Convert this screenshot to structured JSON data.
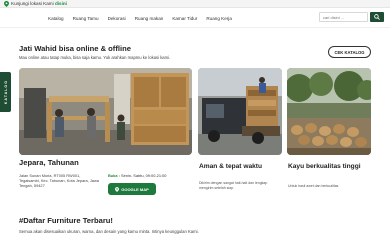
{
  "topbar": {
    "visit_label": "Kunjungi lokasi Kami",
    "visit_link": "disini"
  },
  "nav": {
    "items": [
      "Katalog",
      "Ruang Tamu",
      "Dekorasi",
      "Ruang makan",
      "Kamar Tidur",
      "Ruang Kerja"
    ],
    "search_placeholder": "cari disini ..."
  },
  "side_tab": {
    "label": "KATALOG"
  },
  "hero": {
    "title": "Jati Wahid bisa online & offline",
    "subtitle": "Mau online atau tatap muka, bisa saja kamu. Yuk arahkan mapmu ke lokasi kami.",
    "catalog_button": "CEK KATALOG"
  },
  "cards": {
    "location": {
      "title": "Jepara, Tahunan",
      "address": "Jalan Sunan Muria, RT005 RW001, Tegalsambi, Kec. Tahunan, Kota Jepara, Jawa Tengah, 59427",
      "hours_label": "Buka :",
      "hours_value": "Senin- Sabtu, 09:00-21:00",
      "maps_button": "GOOGLE MAP"
    },
    "shipping": {
      "title": "Aman & tepat waktu",
      "desc": "Dikirim dengan sangat hati-hati dan lengkap mengirim setelah siap."
    },
    "quality": {
      "title": "Kayu berkualitas tinggi",
      "desc": "Untuk hasil awet dan berkualitas"
    }
  },
  "daftar": {
    "title": "#Daftar Furniture Terbaru!",
    "subtitle": "Semua akan disesuaikan ukuran, warna, dan desain yang kamu minta. Intinya keunggulan Kami."
  },
  "colors": {
    "brand_green": "#1f4d33",
    "accent_green": "#1d8a3c",
    "maps_green": "#1d7a3c"
  }
}
